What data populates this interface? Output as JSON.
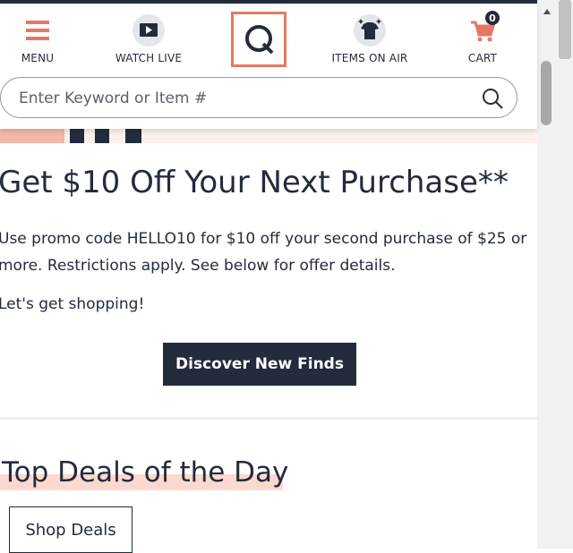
{
  "header": {
    "nav": [
      {
        "label": "MENU",
        "icon": "hamburger-menu-icon"
      },
      {
        "label": "WATCH LIVE",
        "icon": "play-icon"
      },
      {
        "label": "ITEMS ON AIR",
        "icon": "tshirt-sparkle-icon"
      },
      {
        "label": "CART",
        "icon": "cart-icon",
        "count": "0"
      }
    ],
    "logo": "qvc-logo-icon"
  },
  "search": {
    "placeholder": "Enter Keyword or Item #",
    "icon": "search-icon"
  },
  "promo": {
    "title": "Get $10 Off Your Next Purchase**",
    "text": "Use promo code HELLO10 for $10 off your second purchase of $25 or more. Restrictions apply. See below for offer details.",
    "text2": "Let's get shopping!",
    "cta": "Discover New Finds"
  },
  "deals": {
    "title": "Top Deals of the Day",
    "button": "Shop Deals"
  },
  "colors": {
    "accent": "#e57864",
    "navy": "#232b3d",
    "highlight": "#fbd9cf"
  }
}
